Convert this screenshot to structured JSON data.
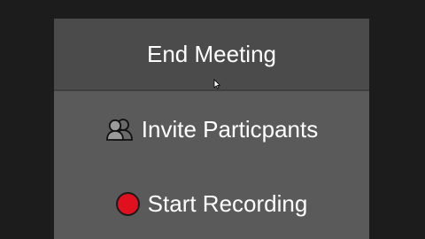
{
  "menu": {
    "end_meeting_label": "End Meeting",
    "invite_label": "Invite Particpants",
    "record_label": "Start Recording"
  },
  "icons": {
    "invite": "participants-icon",
    "record": "record-icon"
  },
  "colors": {
    "background": "#1c1c1c",
    "menu_bg": "#5a5a5a",
    "header_bg": "#4b4b4b",
    "record_red": "#e0101e",
    "text": "#ffffff"
  }
}
